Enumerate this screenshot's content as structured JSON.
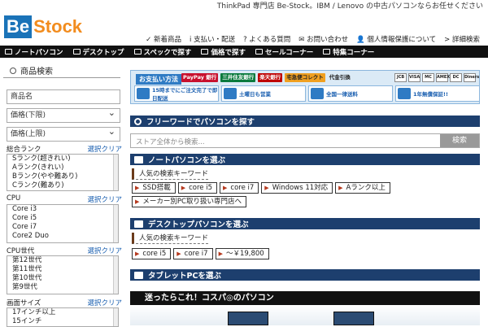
{
  "brand": {
    "logo_part1": "Be",
    "logo_part2": "Stock",
    "tagline": "ThinkPad 専門店 Be-Stock。IBM / Lenovo の中古パソコンならお任せください"
  },
  "top_links": [
    {
      "icon": "cart-icon",
      "label": "✓ 新着商品"
    },
    {
      "icon": "info-icon",
      "label": "i 支払い・配送"
    },
    {
      "icon": "help-icon",
      "label": "? よくある質問"
    },
    {
      "icon": "mail-icon",
      "label": "✉ お問い合わせ"
    },
    {
      "icon": "person-icon",
      "label": "👤 個人情報保護について"
    },
    {
      "icon": "chevron-icon",
      "label": "> 詳細検索"
    }
  ],
  "nav": [
    "ノートパソコン",
    "デスクトップ",
    "スペックで探す",
    "価格で探す",
    "セールコーナー",
    "特集コーナー"
  ],
  "sidebar": {
    "title": "商品検索",
    "name_placeholder": "商品名",
    "price_min": "価格(下限)",
    "price_max": "価格(上限)",
    "clear": "選択クリア",
    "rank": {
      "label": "総合ランク",
      "options": [
        "Sランク(超きれい)",
        "Aランク(きれい)",
        "Bランク(やや難あり)",
        "Cランク(難あり)"
      ]
    },
    "cpu": {
      "label": "CPU",
      "options": [
        "Core i3",
        "Core i5",
        "Core i7",
        "Core2 Duo"
      ]
    },
    "cpu_gen": {
      "label": "CPU世代",
      "options": [
        "第12世代",
        "第11世代",
        "第10世代",
        "第9世代"
      ]
    },
    "screen": {
      "label": "画面サイズ",
      "options": [
        "17インチ以上",
        "15インチ"
      ]
    }
  },
  "payment": {
    "label": "お支払い方法",
    "logos": [
      "PayPay 銀行",
      "三井住友銀行",
      "楽天銀行",
      "代金引換"
    ],
    "cod_brand": "宅急便コレクト",
    "cards": [
      "JCB",
      "VISA",
      "MC",
      "AMEX",
      "DC",
      "Diners"
    ],
    "features": [
      "15時までにご注文完了で即日配送",
      "土曜日も営業",
      "全国一律送料",
      "1年無償保証!!"
    ]
  },
  "sections": {
    "freeword": {
      "title": "フリーワードでパソコンを探す",
      "placeholder": "ストア全体から検索...",
      "button": "検索"
    },
    "notebook": {
      "title": "ノートパソコンを選ぶ",
      "kw_label": "人気の検索キーワード",
      "chips": [
        "SSD搭載",
        "core i5",
        "core i7",
        "Windows 11対応",
        "Aランク以上",
        "メーカー別PC取り扱い専門店へ"
      ]
    },
    "desktop": {
      "title": "デスクトップパソコンを選ぶ",
      "kw_label": "人気の検索キーワード",
      "chips": [
        "core i5",
        "core i7",
        "～￥19,800"
      ]
    },
    "tablet": {
      "title": "タブレットPCを選ぶ"
    },
    "best": {
      "title": "迷ったらこれ！コスパ◎のパソコン"
    }
  }
}
